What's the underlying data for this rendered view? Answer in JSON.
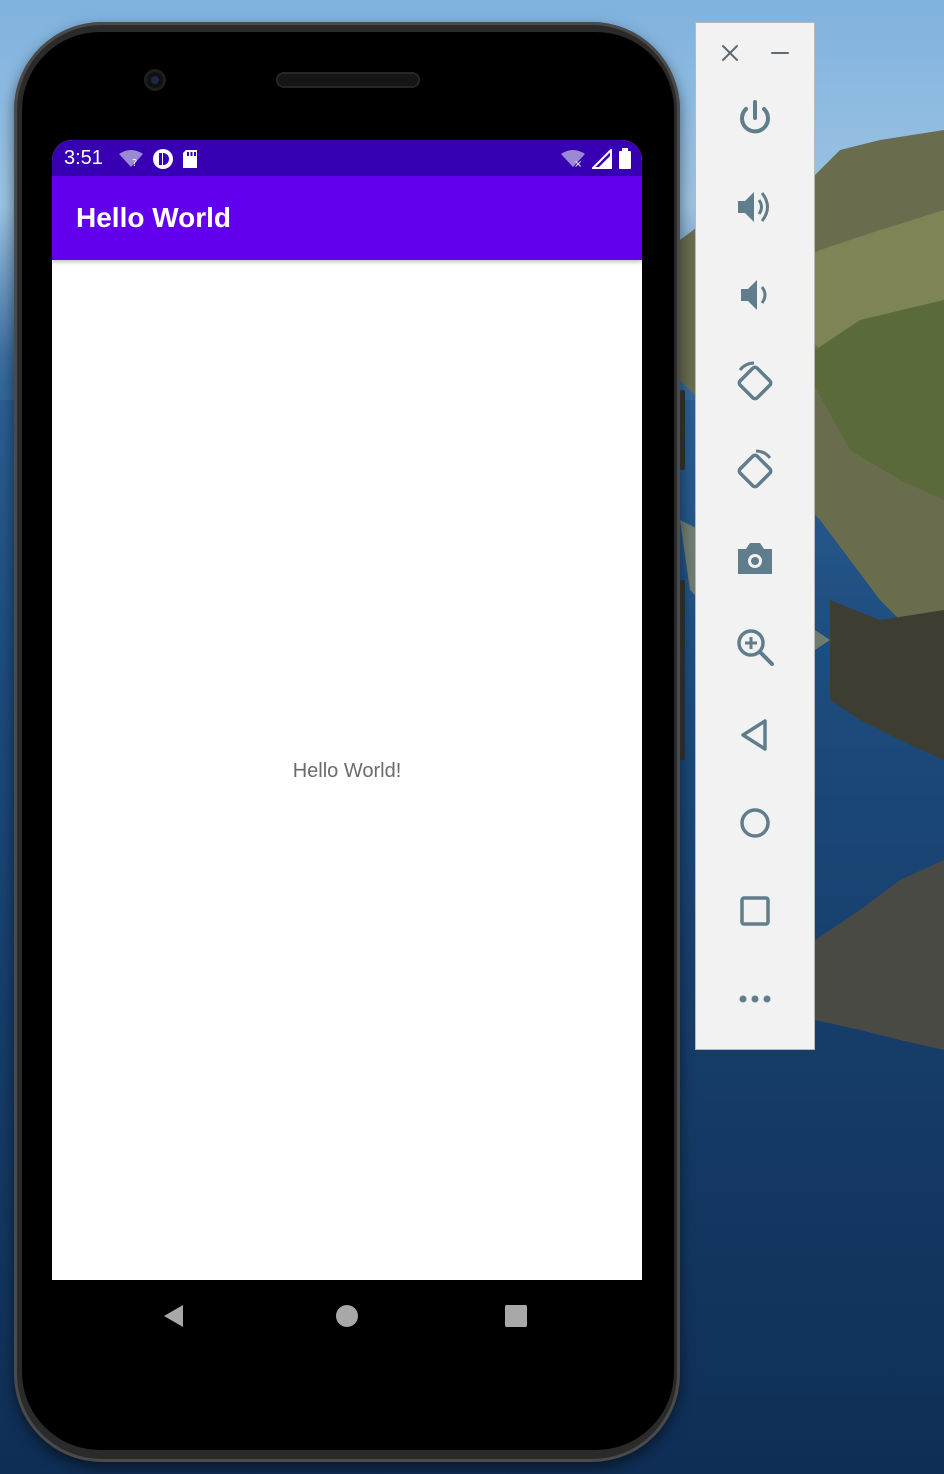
{
  "status_bar": {
    "time": "3:51",
    "icons_left": [
      "wifi-unknown-icon",
      "app-notification-icon",
      "sd-card-icon"
    ],
    "icons_right": [
      "wifi-off-icon",
      "cell-signal-icon",
      "battery-icon"
    ]
  },
  "app_bar": {
    "title": "Hello World"
  },
  "content": {
    "text": "Hello World!"
  },
  "nav_bar": {
    "buttons": [
      "back-icon",
      "home-icon",
      "recents-icon"
    ]
  },
  "emulator_toolbar": {
    "window_controls": [
      "close-icon",
      "minimize-icon"
    ],
    "buttons": [
      "power",
      "volume-up",
      "volume-down",
      "rotate-left",
      "rotate-right",
      "screenshot",
      "zoom",
      "back",
      "home",
      "overview",
      "more"
    ]
  },
  "colors": {
    "status_bar": "#3700b3",
    "app_bar": "#6200ee",
    "toolbar_icon": "#607d8b"
  }
}
